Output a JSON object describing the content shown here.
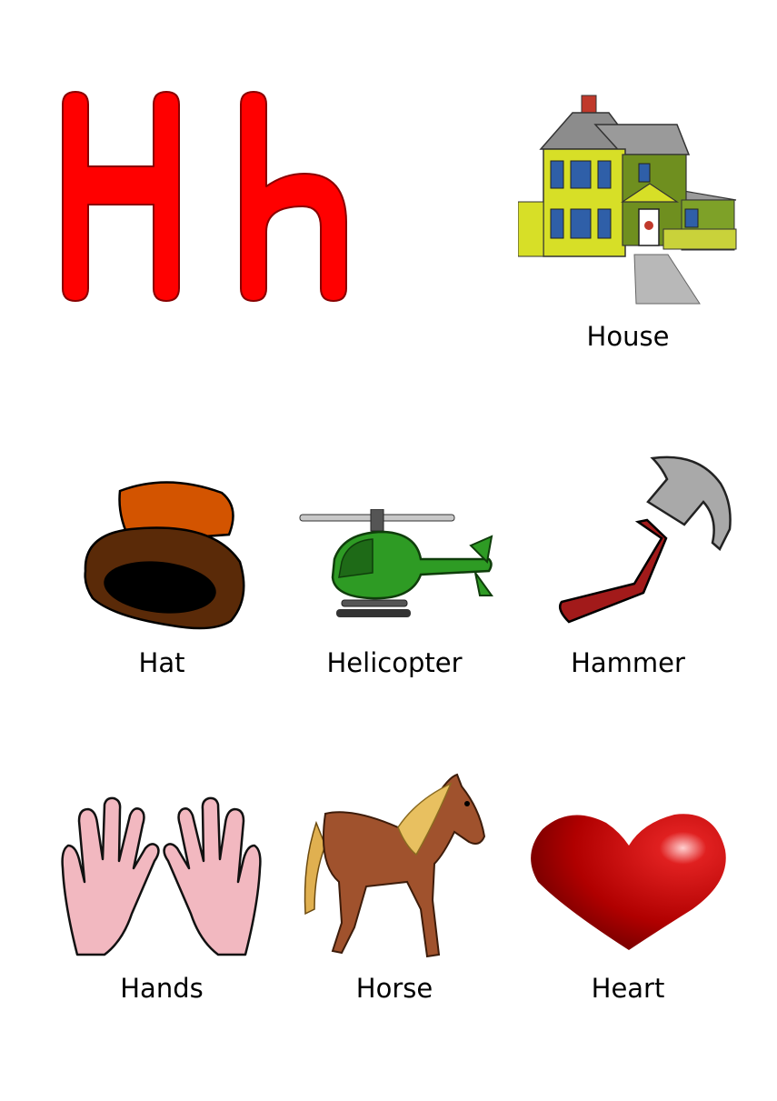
{
  "letter": {
    "upper": "H",
    "lower": "h",
    "color": "#ff0000"
  },
  "items": [
    {
      "label": "House",
      "icon": "house-icon"
    },
    {
      "label": "Hat",
      "icon": "hat-icon"
    },
    {
      "label": "Helicopter",
      "icon": "helicopter-icon"
    },
    {
      "label": "Hammer",
      "icon": "hammer-icon"
    },
    {
      "label": "Hands",
      "icon": "hands-icon"
    },
    {
      "label": "Horse",
      "icon": "horse-icon"
    },
    {
      "label": "Heart",
      "icon": "heart-icon"
    }
  ]
}
